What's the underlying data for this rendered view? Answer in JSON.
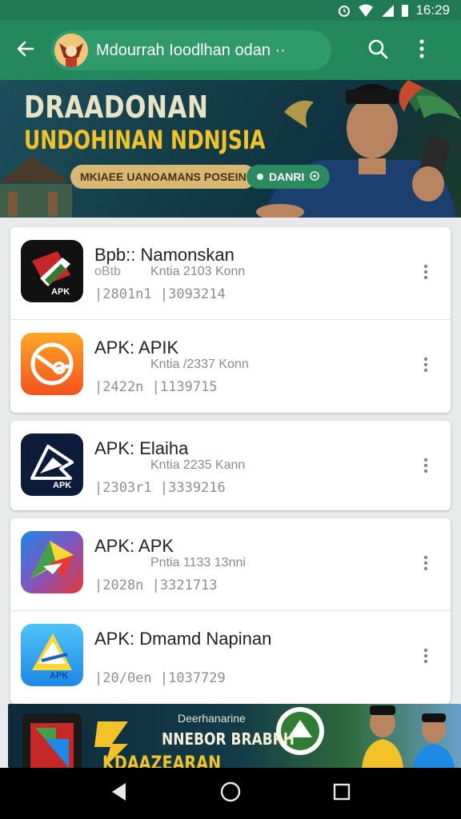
{
  "status_bar": {
    "time": "16:29"
  },
  "app_bar": {
    "title": "Mdourrah Ioodlhan odan ··"
  },
  "hero": {
    "headline": "DRAADONAN",
    "subheadline": "UNDOHINAN NDNJSIA",
    "button_primary": "MKIAEE UANOAMANS POSEIN",
    "button_secondary": "DANRI"
  },
  "apps": [
    {
      "name": "Bpb::  Namonskan",
      "sub": "Kntia 2103 Konn",
      "sub2": "oBtb",
      "meta": "|2801n1  |3093214"
    },
    {
      "name": "APK:  APIK",
      "sub": "Kntia /2337 Konn",
      "sub2": "",
      "meta": "|2422n  |1139715"
    },
    {
      "name": "APK:  Elaiha",
      "sub": "Kntia 2235 Kann",
      "sub2": "",
      "meta": "|2303r1  |3339216"
    },
    {
      "name": "APK:  APK",
      "sub": "Pntia 1133 13nni",
      "sub2": "",
      "meta": "|2028n  |3321713"
    },
    {
      "name": "APK:  Dmamd Napinan",
      "sub": "",
      "sub2": "",
      "meta": "|20/0en  |1037729"
    }
  ],
  "app_icon_labels": [
    "APK",
    "",
    "APK",
    "",
    "APK"
  ],
  "bottom_banner": {
    "line1": "Deerhanarine",
    "line2": "NNEBOR BRABRH",
    "line3": "KDAAZEARAN"
  },
  "colors": {
    "primary": "#23895d",
    "status": "#1f7a55",
    "accent_yellow": "#f2c228"
  }
}
